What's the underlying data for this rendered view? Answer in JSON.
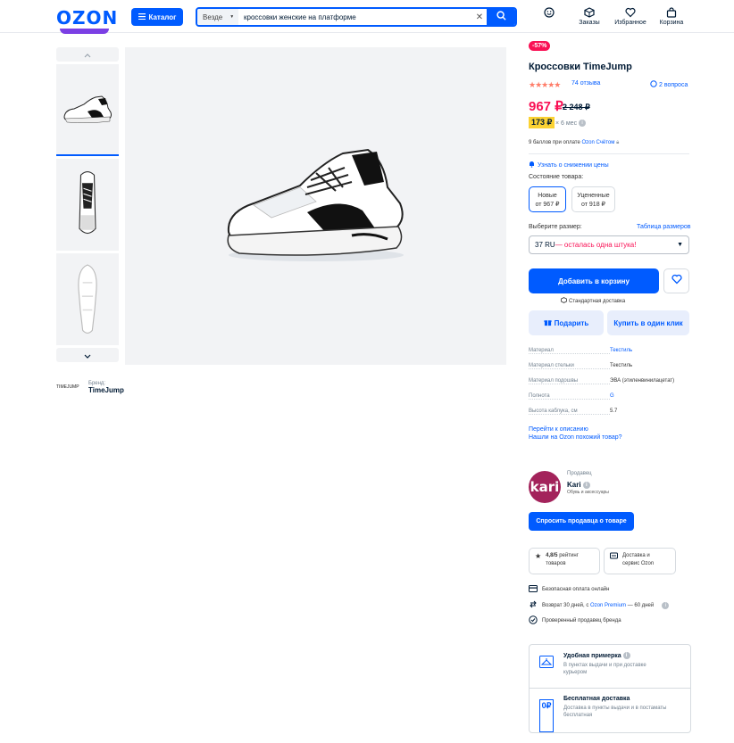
{
  "header": {
    "logo": "OZON",
    "catalog_label": "Каталог",
    "search_scope": "Везде",
    "search_query": "кроссовки женские на платформе",
    "nav": [
      {
        "label": "",
        "icon": "smile-icon"
      },
      {
        "label": "Заказы",
        "icon": "box-icon"
      },
      {
        "label": "Избранное",
        "icon": "heart-icon"
      },
      {
        "label": "Корзина",
        "icon": "bag-icon"
      }
    ]
  },
  "brand": {
    "caption": "Бренд:",
    "name": "TimeJump",
    "logo_text": "TIMEJUMP"
  },
  "product": {
    "discount": "-57%",
    "title": "Кроссовки TimeJump",
    "stars": "★★★★★",
    "reviews": "74 отзыва",
    "questions": "2 вопроса",
    "price": "967 ₽",
    "old_price": "2 248 ₽",
    "installment": "173 ₽",
    "installment_term": "× 6 мес",
    "bonus_prefix": "9 баллов при оплате",
    "bonus_link": "Ozon Счётом",
    "notify": "Узнать о снижении цены",
    "condition_label": "Состояние товара:",
    "conditions": [
      {
        "title": "Новые",
        "price": "от 967 ₽"
      },
      {
        "title": "Уцененные",
        "price": "от 918 ₽"
      }
    ],
    "size_label": "Выберите размер:",
    "size_table": "Таблица размеров",
    "size_value": "37 RU",
    "size_warning": " — осталась одна штука!",
    "add_to_cart": "Добавить в корзину",
    "delivery_std": "Стандартная доставка",
    "gift": "Подарить",
    "one_click": "Купить в один клик",
    "specs": [
      {
        "k": "Материал",
        "v": "Текстиль",
        "link": true
      },
      {
        "k": "Материал стельки",
        "v": "Текстиль",
        "link": false
      },
      {
        "k": "Материал подошвы",
        "v": "ЭВА (этиленвинилацетат)",
        "link": false
      },
      {
        "k": "Полнота",
        "v": "G",
        "link": true
      },
      {
        "k": "Высота каблука, см",
        "v": "5.7",
        "link": false
      }
    ],
    "desc_link": "Перейти к описанию",
    "similar_link": "Нашли на Ozon похожий товар?"
  },
  "seller": {
    "caption": "Продавец",
    "logo_text": "kari",
    "name": "Kari",
    "desc": "Обувь и аксессуары",
    "ask": "Спросить продавца о товаре",
    "rating_value": "4,8/5",
    "rating_text_a": "рейтинг",
    "rating_text_b": "товаров",
    "service_a": "Доставка и",
    "service_b": "сервис Ozon",
    "guarantees": {
      "pay": "Безопасная оплата онлайн",
      "return_prefix": "Возврат 30 дней, с",
      "return_link": "Ozon Premium",
      "return_suffix": "— 60 дней",
      "verified": "Проверенный продавец бренда"
    }
  },
  "perks": [
    {
      "title": "Удобная примерка",
      "desc_a": "В пунктах выдачи и при доставке",
      "desc_b": "курьером"
    },
    {
      "title": "Бесплатная доставка",
      "desc_a": "Доставка в пункты выдачи и в постаматы",
      "desc_b": "бесплатная",
      "icon_text": "0₽"
    }
  ],
  "colors": {
    "brand_blue": "#005bff",
    "price_pink": "#f91155",
    "installment_yellow": "#fbd233",
    "seller_purple": "#a3235b"
  }
}
